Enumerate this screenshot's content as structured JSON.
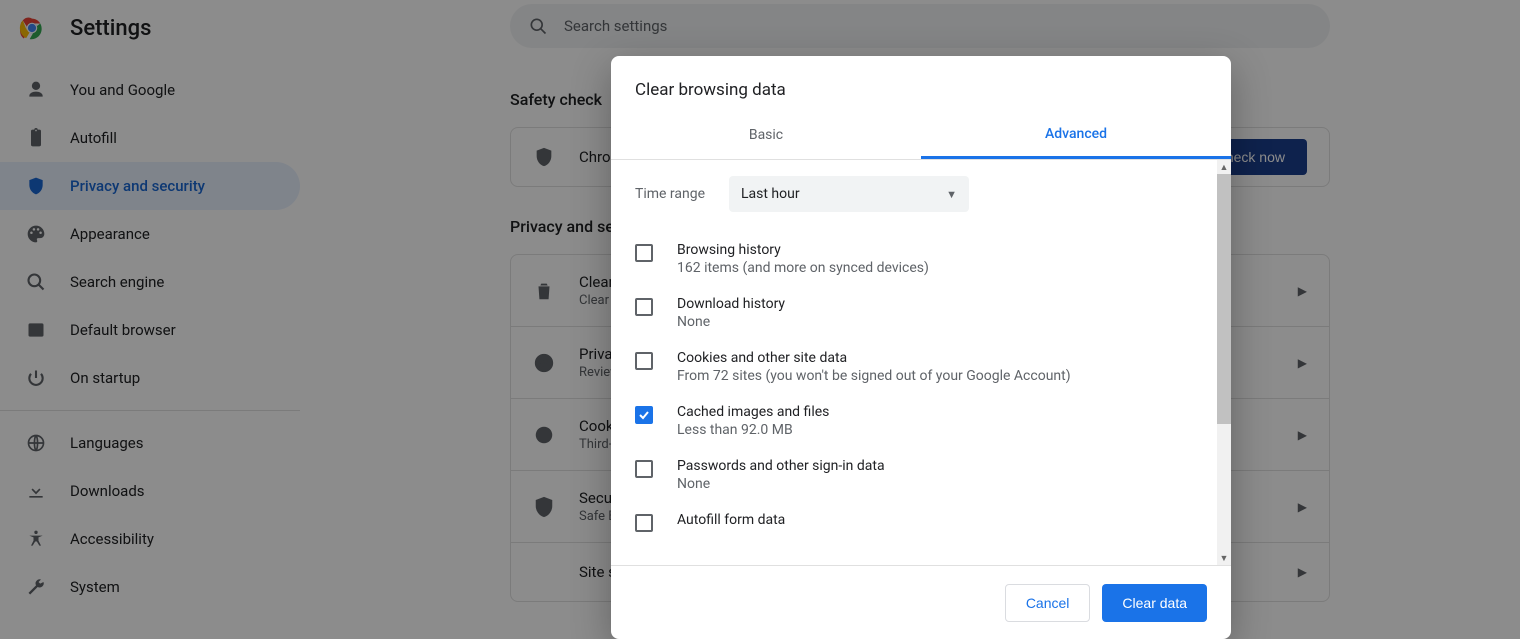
{
  "app": {
    "title": "Settings",
    "search_placeholder": "Search settings"
  },
  "sidebar": {
    "items": [
      {
        "label": "You and Google"
      },
      {
        "label": "Autofill"
      },
      {
        "label": "Privacy and security"
      },
      {
        "label": "Appearance"
      },
      {
        "label": "Search engine"
      },
      {
        "label": "Default browser"
      },
      {
        "label": "On startup"
      },
      {
        "label": "Languages"
      },
      {
        "label": "Downloads"
      },
      {
        "label": "Accessibility"
      },
      {
        "label": "System"
      }
    ]
  },
  "sections": {
    "safety_title": "Safety check",
    "safety_row_title": "Chrome can help keep you safe",
    "safety_button": "Check now",
    "ps_title": "Privacy and security",
    "rows": [
      {
        "title": "Clear browsing data",
        "sub": "Clear history, cookies, cache, and more"
      },
      {
        "title": "Privacy Guide",
        "sub": "Review key privacy and security controls"
      },
      {
        "title": "Cookies and other site data",
        "sub": "Third-party cookies are blocked in Incognito mode"
      },
      {
        "title": "Security",
        "sub": "Safe Browsing (protection from dangerous sites) and other security settings"
      },
      {
        "title": "Site settings",
        "sub": ""
      }
    ]
  },
  "dialog": {
    "title": "Clear browsing data",
    "tabs": {
      "basic": "Basic",
      "advanced": "Advanced"
    },
    "time_label": "Time range",
    "time_value": "Last hour",
    "items": [
      {
        "title": "Browsing history",
        "sub": "162 items (and more on synced devices)",
        "checked": false
      },
      {
        "title": "Download history",
        "sub": "None",
        "checked": false
      },
      {
        "title": "Cookies and other site data",
        "sub": "From 72 sites (you won't be signed out of your Google Account)",
        "checked": false
      },
      {
        "title": "Cached images and files",
        "sub": "Less than 92.0 MB",
        "checked": true
      },
      {
        "title": "Passwords and other sign-in data",
        "sub": "None",
        "checked": false
      },
      {
        "title": "Autofill form data",
        "sub": "",
        "checked": false
      }
    ],
    "cancel": "Cancel",
    "confirm": "Clear data"
  }
}
